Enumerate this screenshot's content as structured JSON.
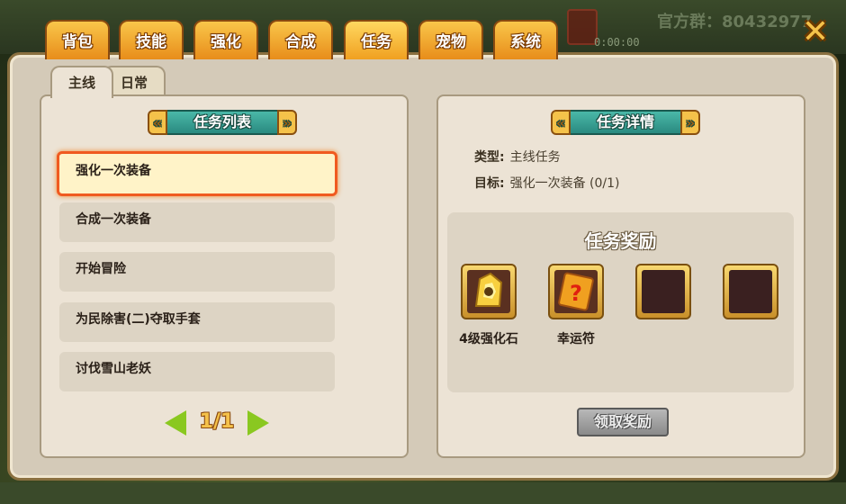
{
  "top_bar": {
    "group_text": "官方群：80432977",
    "timer": "0:00:00"
  },
  "tabs": [
    {
      "label": "背包"
    },
    {
      "label": "技能"
    },
    {
      "label": "强化"
    },
    {
      "label": "合成"
    },
    {
      "label": "任务",
      "active": true
    },
    {
      "label": "宠物"
    },
    {
      "label": "系统"
    }
  ],
  "close_icon": "close-x-icon",
  "subtabs": [
    {
      "label": "主线",
      "active": true
    },
    {
      "label": "日常",
      "active": false
    }
  ],
  "quest_list": {
    "title": "任务列表",
    "items": [
      {
        "label": "强化一次装备",
        "selected": true
      },
      {
        "label": "合成一次装备",
        "selected": false
      },
      {
        "label": "开始冒险",
        "selected": false
      },
      {
        "label": "为民除害(二)夺取手套",
        "selected": false
      },
      {
        "label": "讨伐雪山老妖",
        "selected": false
      }
    ],
    "pager": "1/1"
  },
  "detail": {
    "title": "任务详情",
    "type_label": "类型:",
    "type_value": "主线任务",
    "goal_label": "目标:",
    "goal_value": "强化一次装备 (0/1)"
  },
  "rewards": {
    "title": "任务奖励",
    "items": [
      {
        "label": "4级强化石",
        "icon": "strengthen-stone-icon"
      },
      {
        "label": "幸运符",
        "icon": "lucky-charm-icon"
      },
      {
        "label": "",
        "icon": "empty-slot"
      },
      {
        "label": "",
        "icon": "empty-slot"
      }
    ],
    "claim_button": "领取奖励"
  },
  "colors": {
    "tab_gold": "#f9c64a",
    "banner_teal": "#2a8a80",
    "selected_border": "#f05a20",
    "panel_bg": "#ece3d5"
  }
}
